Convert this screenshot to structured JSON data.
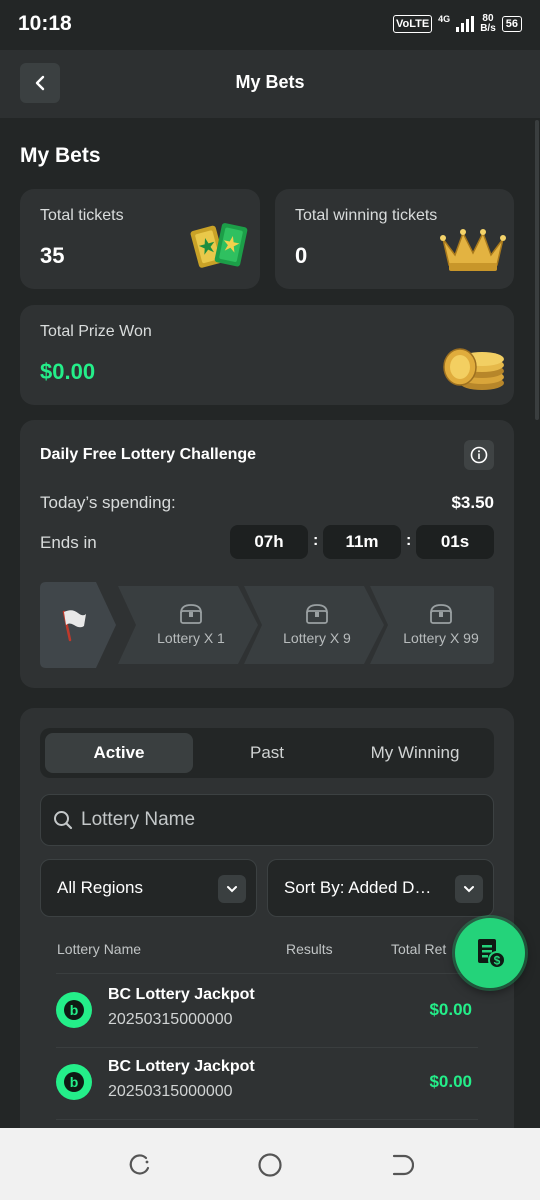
{
  "status_bar": {
    "time": "10:18",
    "network": "VoLTE",
    "network_gen": "4G",
    "speed_value": "80",
    "speed_unit": "B/s",
    "battery": "56"
  },
  "header": {
    "title": "My Bets"
  },
  "section_title": "My Bets",
  "stats": {
    "total_tickets_label": "Total tickets",
    "total_tickets_value": "35",
    "total_winning_label": "Total winning tickets",
    "total_winning_value": "0",
    "prize_label": "Total Prize Won",
    "prize_value": "$0.00"
  },
  "challenge": {
    "title": "Daily Free Lottery Challenge",
    "spending_label": "Today’s spending:",
    "spending_value": "$3.50",
    "ends_label": "Ends in",
    "hours": "07h",
    "minutes": "11m",
    "seconds": "01s",
    "steps": [
      {
        "label": "Lottery X 1"
      },
      {
        "label": "Lottery X 9"
      },
      {
        "label": "Lottery X 99"
      }
    ]
  },
  "tabs": [
    {
      "label": "Active",
      "active": true
    },
    {
      "label": "Past",
      "active": false
    },
    {
      "label": "My Winning",
      "active": false
    }
  ],
  "search": {
    "placeholder": "Lottery Name"
  },
  "filters": {
    "region": "All Regions",
    "sort": "Sort By: Added D…"
  },
  "table": {
    "columns": [
      "Lottery Name",
      "Results",
      "Total Ret"
    ],
    "rows": [
      {
        "name": "BC Lottery Jackpot",
        "id": "20250315000000",
        "total_return": "$0.00"
      },
      {
        "name": "BC Lottery Jackpot",
        "id": "20250315000000",
        "total_return": "$0.00"
      }
    ]
  },
  "colors": {
    "accent_green": "#24ee89",
    "background": "#232626",
    "card": "#2f3233"
  }
}
